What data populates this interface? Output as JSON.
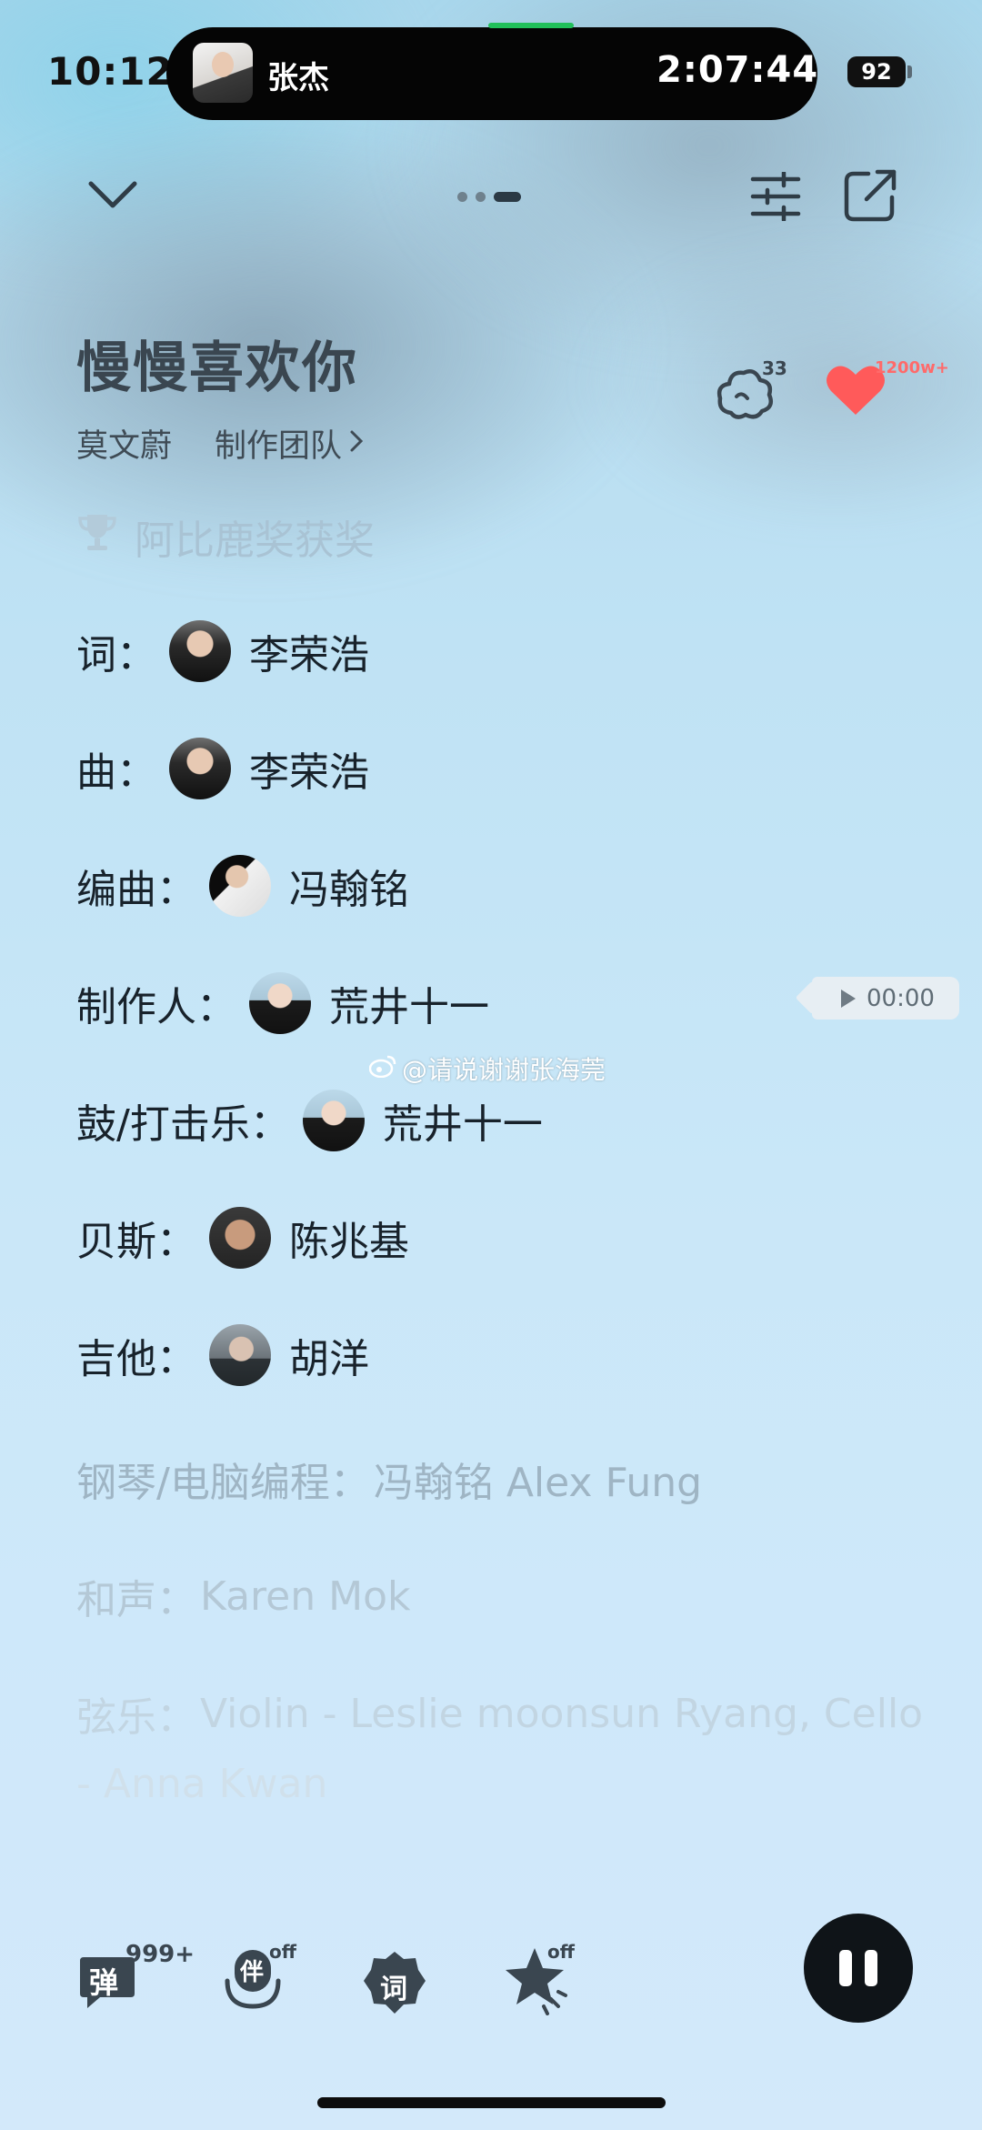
{
  "status_bar": {
    "time": "10:12",
    "island_artist": "张杰",
    "island_timer": "2:07:44",
    "battery": "92"
  },
  "song": {
    "title": "慢慢喜欢你",
    "singer": "莫文蔚",
    "team_label": "制作团队",
    "award": "阿比鹿奖获奖",
    "comment_count": "33",
    "like_count": "1200w+"
  },
  "credits": [
    {
      "role": "词：",
      "name": "李荣浩"
    },
    {
      "role": "曲：",
      "name": "李荣浩"
    },
    {
      "role": "编曲：",
      "name": "冯翰铭"
    },
    {
      "role": "制作人：",
      "name": "荒井十一"
    },
    {
      "role": "鼓/打击乐：",
      "name": "荒井十一"
    },
    {
      "role": "贝斯：",
      "name": "陈兆基"
    },
    {
      "role": "吉他：",
      "name": "胡洋"
    },
    {
      "role": "钢琴/电脑编程：",
      "name": "冯翰铭 Alex Fung"
    },
    {
      "role": "和声：",
      "name": "Karen Mok"
    },
    {
      "role": "弦乐：",
      "name": "Violin - Leslie moonsun Ryang, Cello",
      "name_cont": "- Anna Kwan"
    }
  ],
  "preview": {
    "time": "00:00"
  },
  "watermark": "@请说谢谢张海莞",
  "toolbar": {
    "danmaku_label": "弹",
    "danmaku_badge": "999+",
    "accompany_label": "伴",
    "accompany_state": "off",
    "lyrics_label": "词",
    "effect_state": "off"
  },
  "icons": {
    "collapse": "chevron-down-icon",
    "equalizer": "sliders-icon",
    "share": "share-icon",
    "comment": "comment-cloud-icon",
    "like": "heart-icon",
    "award": "trophy-icon",
    "play_preview": "play-icon",
    "pause": "pause-icon"
  },
  "colors": {
    "heart": "#ff5a5a",
    "island_progress": "#21c05a",
    "faded_text": "#9fb5c4"
  }
}
